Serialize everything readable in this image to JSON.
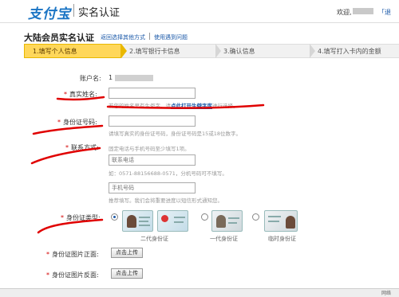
{
  "header": {
    "logo_text": "支付宝",
    "title": "实名认证",
    "welcome": "欢迎,",
    "link": "「退"
  },
  "page": {
    "title": "大陆会员实名认证",
    "alt_link": "返回选择其他方式",
    "problem_link": "使用遇到问题"
  },
  "steps": [
    {
      "label": "1.填写个人信息"
    },
    {
      "label": "2.填写银行卡信息"
    },
    {
      "label": "3.确认信息"
    },
    {
      "label": "4.填写打入卡内的金额"
    }
  ],
  "form": {
    "account_label": "账户名:",
    "account_value": "1",
    "name_label": "真实姓名:",
    "name_hint_prefix": "若您的姓名里有生僻字，请",
    "name_hint_link": "点此打开生僻字库",
    "name_hint_suffix": "进行选择。",
    "id_label": "身份证号码:",
    "id_hint": "请填写真实的身份证号码，身份证号码是15或18位数字。",
    "contact_label": "联系方式:",
    "contact_hint": "固定电话与手机号码至少填写1项。",
    "phone_placeholder": "联系电话",
    "phone_example": "如：0571-88156688-0571，分机号码可不填写。",
    "mobile_placeholder": "手机号码",
    "mobile_hint": "推荐填写。我们会将重要进度以短信形式通知您。",
    "id_type_label": "身份证类型:",
    "id_types": [
      {
        "label": "二代身份证",
        "selected": true
      },
      {
        "label": "一代身份证",
        "selected": false
      },
      {
        "label": "临时身份证",
        "selected": false
      }
    ],
    "front_label": "身份证图片正面:",
    "back_label": "身份证图片反面:",
    "upload_label": "点击上传"
  },
  "status": {
    "text": "网络"
  },
  "colors": {
    "brand": "#1a74c4",
    "link": "#1a58a8",
    "active_step": "#ffd75a",
    "required": "#d40000",
    "scribble": "#e00000"
  }
}
